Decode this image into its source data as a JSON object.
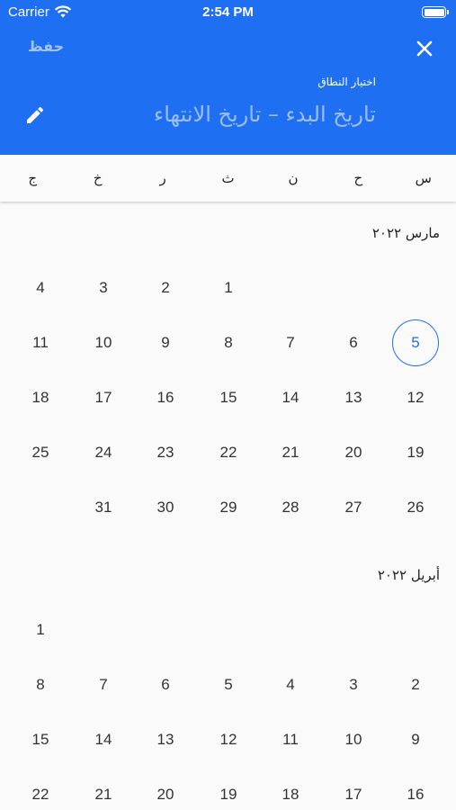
{
  "status": {
    "carrier": "Carrier",
    "time": "2:54 PM"
  },
  "header": {
    "save_label": "حفظ",
    "subtitle": "اختيار النطاق",
    "range_label": "تاريخ البدء – تاريخ الانتهاء"
  },
  "weekdays": [
    "س",
    "ح",
    "ن",
    "ث",
    "ر",
    "خ",
    "ج"
  ],
  "months": [
    {
      "title": "مارس ٢٠٢٢",
      "weeks": [
        [
          "",
          "",
          "",
          "1",
          "2",
          "3",
          "4"
        ],
        [
          "5",
          "6",
          "7",
          "8",
          "9",
          "10",
          "11"
        ],
        [
          "12",
          "13",
          "14",
          "15",
          "16",
          "17",
          "18"
        ],
        [
          "19",
          "20",
          "21",
          "22",
          "23",
          "24",
          "25"
        ],
        [
          "26",
          "27",
          "28",
          "29",
          "30",
          "31",
          ""
        ]
      ]
    },
    {
      "title": "أبريل ٢٠٢٢",
      "weeks": [
        [
          "",
          "",
          "",
          "",
          "",
          "",
          "1"
        ],
        [
          "2",
          "3",
          "4",
          "5",
          "6",
          "7",
          "8"
        ],
        [
          "9",
          "10",
          "11",
          "12",
          "13",
          "14",
          "15"
        ],
        [
          "16",
          "17",
          "18",
          "19",
          "20",
          "21",
          "22"
        ]
      ]
    }
  ],
  "today": "5",
  "colors": {
    "primary": "#1f6ff2",
    "save_disabled": "#a7c4f8",
    "range_hint": "#9dbdf6"
  },
  "icons": {
    "close": "close-icon",
    "edit": "pencil-icon",
    "wifi": "wifi-icon",
    "battery": "battery-icon"
  }
}
